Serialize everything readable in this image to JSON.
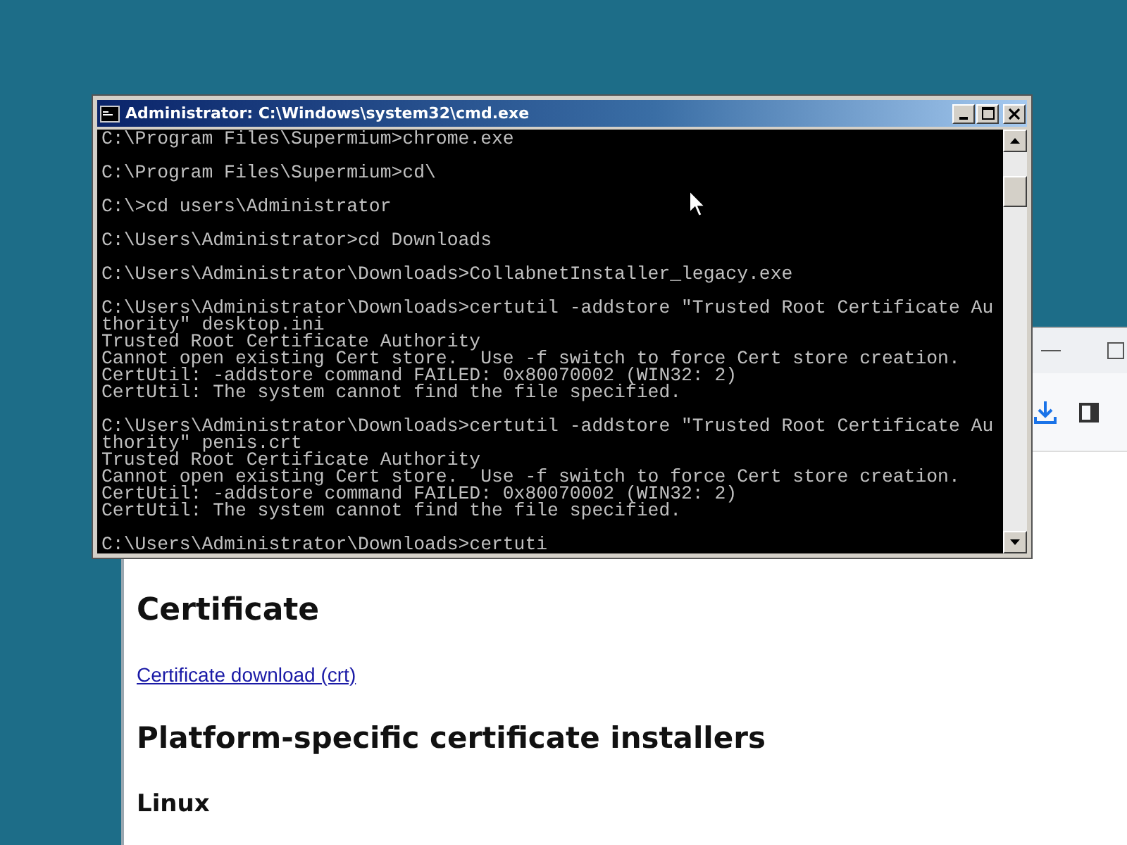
{
  "cmd_window": {
    "title": "Administrator: C:\\Windows\\system32\\cmd.exe",
    "console_blocks": [
      [
        "C:\\Program Files\\Supermium>chrome.exe"
      ],
      [
        "C:\\Program Files\\Supermium>cd\\"
      ],
      [
        "C:\\>cd users\\Administrator"
      ],
      [
        "C:\\Users\\Administrator>cd Downloads"
      ],
      [
        "C:\\Users\\Administrator\\Downloads>CollabnetInstaller_legacy.exe"
      ],
      [
        "C:\\Users\\Administrator\\Downloads>certutil -addstore \"Trusted Root Certificate Au",
        "thority\" desktop.ini",
        "Trusted Root Certificate Authority",
        "Cannot open existing Cert store.  Use -f switch to force Cert store creation.",
        "CertUtil: -addstore command FAILED: 0x80070002 (WIN32: 2)",
        "CertUtil: The system cannot find the file specified."
      ],
      [
        "C:\\Users\\Administrator\\Downloads>certutil -addstore \"Trusted Root Certificate Au",
        "thority\" penis.crt",
        "Trusted Root Certificate Authority",
        "Cannot open existing Cert store.  Use -f switch to force Cert store creation.",
        "CertUtil: -addstore command FAILED: 0x80070002 (WIN32: 2)",
        "CertUtil: The system cannot find the file specified."
      ],
      [
        "C:\\Users\\Administrator\\Downloads>certuti"
      ]
    ]
  },
  "browser_window": {
    "page": {
      "heading": "Certificate",
      "link": "Certificate download (crt)",
      "section_heading": "Platform-specific certificate installers",
      "subheading": "Linux"
    }
  }
}
